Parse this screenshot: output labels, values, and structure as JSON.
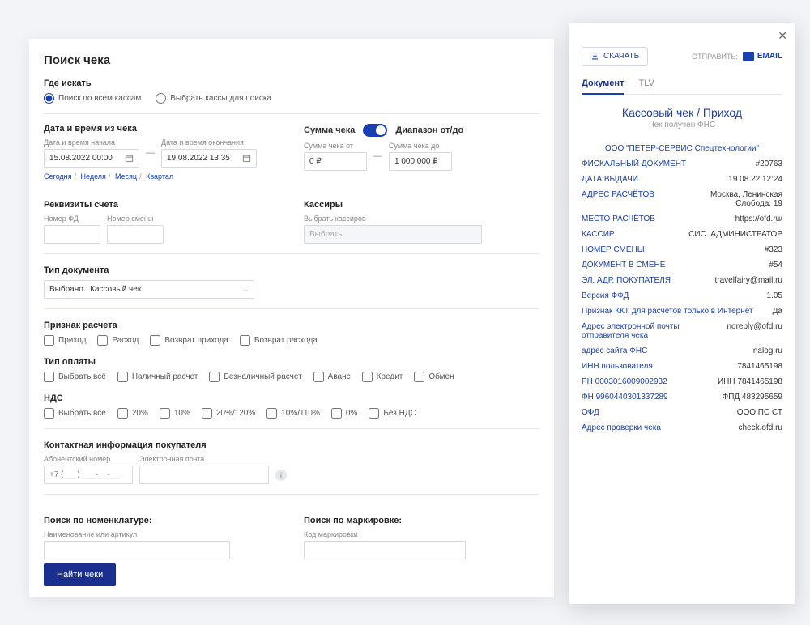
{
  "panel": {
    "title": "Поиск чека",
    "where_label": "Где искать",
    "radio_all": "Поиск по всем кассам",
    "radio_select": "Выбрать кассы для поиска",
    "date_section": "Дата и время из чека",
    "date_start_label": "Дата и время начала",
    "date_end_label": "Дата и время окончания",
    "date_start": "15.08.2022 00:00",
    "date_end": "19.08.2022 13:35",
    "link_today": "Сегодня",
    "link_week": "Неделя",
    "link_month": "Месяц",
    "link_quarter": "Квартал",
    "sum_section": "Сумма чека",
    "range_label": "Диапазон от/до",
    "sum_from_label": "Сумма чека от",
    "sum_to_label": "Сумма чека до",
    "sum_from": "0 ₽",
    "sum_to": "1 000 000 ₽",
    "rekv_section": "Реквизиты счета",
    "fd_label": "Номер ФД",
    "shift_label": "Номер смены",
    "cashiers_section": "Кассиры",
    "cashiers_hint": "Выбрать кассиров",
    "cashiers_placeholder": "Выбрать",
    "doctype_section": "Тип документа",
    "doctype_value": "Выбрано : Кассовый чек",
    "priznak_section": "Признак расчета",
    "priznak_opts": [
      "Приход",
      "Расход",
      "Возврат прихода",
      "Возврат расхода"
    ],
    "paytype_section": "Тип оплаты",
    "paytype_opts": [
      "Выбрать всё",
      "Наличный расчет",
      "Безналичный расчет",
      "Аванс",
      "Кредит",
      "Обмен"
    ],
    "nds_section": "НДС",
    "nds_opts": [
      "Выбрать всё",
      "20%",
      "10%",
      "20%/120%",
      "10%/110%",
      "0%",
      "Без НДС"
    ],
    "contact_section": "Контактная информация покупателя",
    "phone_label": "Абонентский номер",
    "phone_placeholder": "+7 (___) ___-__-__",
    "email_label": "Электронная почта",
    "nomen_section": "Поиск по номенклатуре:",
    "nomen_label": "Наименование или артикул",
    "mark_section": "Поиск по маркировке:",
    "mark_label": "Код маркировки",
    "find_btn": "Найти чеки"
  },
  "side": {
    "download": "СКАЧАТЬ",
    "send_label": "ОТПРАВИТЬ:",
    "email_link": "EMAIL",
    "tab_doc": "Документ",
    "tab_tlv": "TLV",
    "receipt_title": "Кассовый чек / Приход",
    "receipt_sub": "Чек получен ФНС",
    "company": "ООО \"ПЕТЕР-СЕРВИС Спецтехнологии\"",
    "rows": [
      {
        "label": "ФИСКАЛЬНЫЙ ДОКУМЕНТ",
        "value": "#20763"
      },
      {
        "label": "ДАТА ВЫДАЧИ",
        "value": "19.08.22 12:24"
      },
      {
        "label": "АДРЕС РАСЧЁТОВ",
        "value": "Москва, Ленинская Слобода, 19"
      },
      {
        "label": "МЕСТО РАСЧЁТОВ",
        "value": "https://ofd.ru/"
      },
      {
        "label": "КАССИР",
        "value": "СИС. АДМИНИСТРАТОР"
      },
      {
        "label": "НОМЕР СМЕНЫ",
        "value": "#323"
      },
      {
        "label": "ДОКУМЕНТ В СМЕНЕ",
        "value": "#54"
      },
      {
        "label": "ЭЛ. АДР. ПОКУПАТЕЛЯ",
        "value": "travelfairy@mail.ru"
      },
      {
        "label": "Версия ФФД",
        "value": "1.05"
      },
      {
        "label": "Признак ККТ для расчетов только в Интернет",
        "value": "Да"
      },
      {
        "label": "Адрес электронной почты отправителя чека",
        "value": "noreply@ofd.ru"
      },
      {
        "label": "адрес сайта ФНС",
        "value": "nalog.ru"
      },
      {
        "label": "ИНН пользователя",
        "value": "7841465198"
      },
      {
        "label": "РН 0003016009002932",
        "value": "ИНН 7841465198"
      },
      {
        "label": "ФН 9960440301337289",
        "value": "ФПД 483295659"
      },
      {
        "label": "ОФД",
        "value": "ООО ПС СТ"
      },
      {
        "label": "Адрес проверки чека",
        "value": "check.ofd.ru"
      }
    ]
  }
}
